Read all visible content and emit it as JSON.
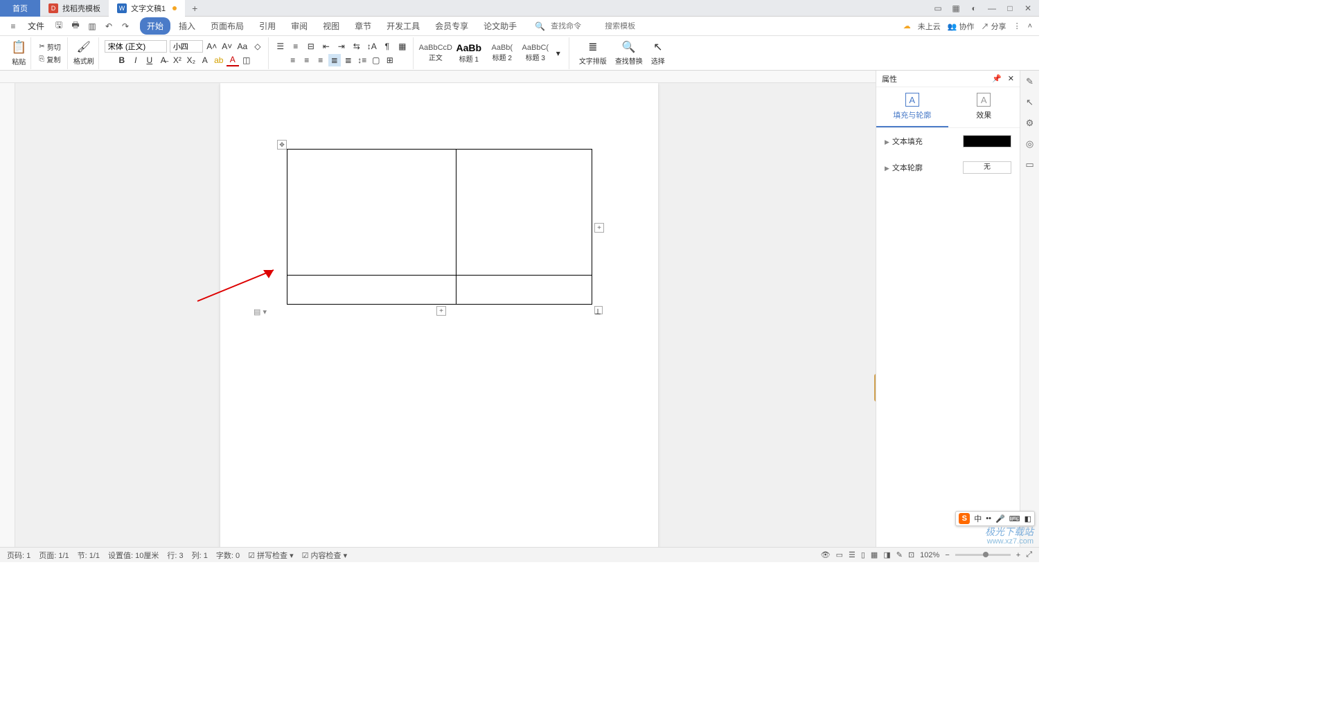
{
  "titlebar": {
    "tabs": [
      {
        "label": "首页"
      },
      {
        "label": "找稻壳模板"
      },
      {
        "label": "文字文稿1"
      }
    ]
  },
  "menubar": {
    "file": "文件",
    "tabs": [
      "开始",
      "插入",
      "页面布局",
      "引用",
      "审阅",
      "视图",
      "章节",
      "开发工具",
      "会员专享",
      "论文助手"
    ],
    "search_cmd": "查找命令",
    "search_tpl": "搜索模板",
    "cloud": "未上云",
    "collab": "协作",
    "share": "分享"
  },
  "ribbon": {
    "paste": "粘贴",
    "cut": "剪切",
    "copy": "复制",
    "format_painter": "格式刷",
    "font_name": "宋体 (正文)",
    "font_size": "小四",
    "styles": {
      "normal_preview": "AaBbCcD",
      "normal_label": "正文",
      "h1_preview": "AaBb",
      "h1_label": "标题 1",
      "h2_preview": "AaBb(",
      "h2_label": "标题 2",
      "h3_preview": "AaBbC(",
      "h3_label": "标题 3"
    },
    "text_layout": "文字排版",
    "find_replace": "查找替换",
    "select": "选择"
  },
  "rpanel": {
    "title": "属性",
    "tab_fill": "填充与轮廓",
    "tab_effect": "效果",
    "text_fill": "文本填充",
    "text_outline": "文本轮廓",
    "outline_value": "无"
  },
  "statusbar": {
    "page_no": "页码: 1",
    "page": "页面: 1/1",
    "section": "节: 1/1",
    "setting": "设置值: 10厘米",
    "row": "行: 3",
    "col": "列: 1",
    "words": "字数: 0",
    "spell": "拼写检查",
    "content": "内容检查",
    "zoom": "102%"
  },
  "ime": {
    "lang": "中"
  },
  "watermark": {
    "brand": "极光下载站",
    "url": "www.xz7.com"
  }
}
